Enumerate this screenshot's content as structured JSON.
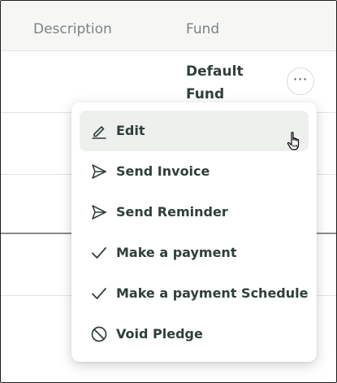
{
  "table": {
    "columns": [
      "Description",
      "Fund"
    ],
    "row": {
      "fund_line1": "Default",
      "fund_line2": "Fund"
    }
  },
  "row_menu": {
    "button_glyph": "⋯",
    "items": [
      {
        "label": "Edit",
        "icon": "pencil-icon",
        "hovered": true
      },
      {
        "label": "Send Invoice",
        "icon": "send-icon"
      },
      {
        "label": "Send Reminder",
        "icon": "send-icon"
      },
      {
        "label": "Make a payment",
        "icon": "checkmark-icon"
      },
      {
        "label": "Make a payment Schedule",
        "icon": "checkmark-icon"
      },
      {
        "label": "Void Pledge",
        "icon": "void-icon"
      }
    ]
  },
  "colors": {
    "text": "#2f3f3c",
    "header_bg": "#f6f7f5",
    "muted": "#7a8482",
    "hover_bg": "#eef0ee"
  }
}
